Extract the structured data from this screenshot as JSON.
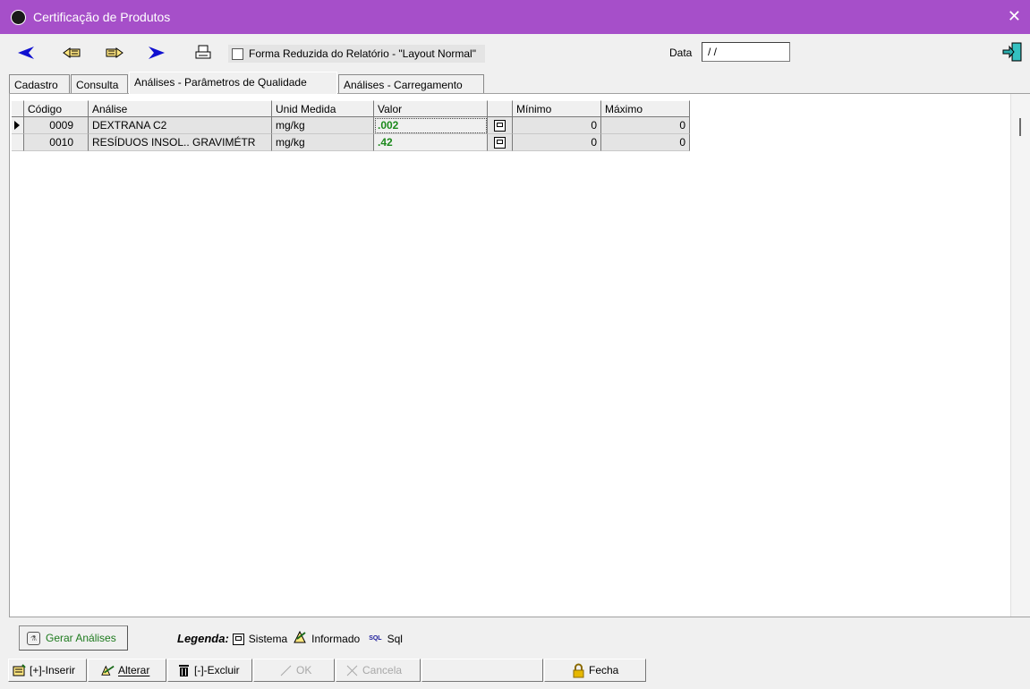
{
  "window": {
    "title": "Certificação de Produtos"
  },
  "toolbar": {
    "checkbox_label": "Forma Reduzida do Relatório - \"Layout Normal\"",
    "checkbox_checked": false,
    "date_label": "Data",
    "date_value": " / /"
  },
  "tabs": [
    {
      "label": "Cadastro",
      "active": false
    },
    {
      "label": "Consulta",
      "active": false
    },
    {
      "label": "Análises - Parâmetros de Qualidade",
      "active": true
    },
    {
      "label": "Análises - Carregamento",
      "active": false
    }
  ],
  "grid": {
    "columns": [
      "Código",
      "Análise",
      "Unid Medida",
      "Valor",
      "",
      "Mínimo",
      "Máximo"
    ],
    "rows": [
      {
        "codigo": "0009",
        "analise": "DEXTRANA C2",
        "unid": "mg/kg",
        "valor": ".002",
        "tipo_icon": "sistema-icon",
        "minimo": "0",
        "maximo": "0",
        "current": true
      },
      {
        "codigo": "0010",
        "analise": "RESÍDUOS INSOL.. GRAVIMÉTR",
        "unid": "mg/kg",
        "valor": ".42",
        "tipo_icon": "sistema-icon",
        "minimo": "0",
        "maximo": "0",
        "current": false
      }
    ]
  },
  "legend": {
    "gerar_label": "Gerar Análises",
    "title": "Legenda:",
    "sistema": "Sistema",
    "informado": "Informado",
    "sql_badge": "SQL",
    "sql": "Sql"
  },
  "bottom": {
    "inserir": "[+]-Inserir",
    "alterar": "Alterar",
    "excluir": "[-]-Excluir",
    "ok": "OK",
    "cancela": "Cancela",
    "fecha": "Fecha"
  },
  "colors": {
    "titlebar": "#a64fc9",
    "valor_text": "#1d8a1d"
  }
}
